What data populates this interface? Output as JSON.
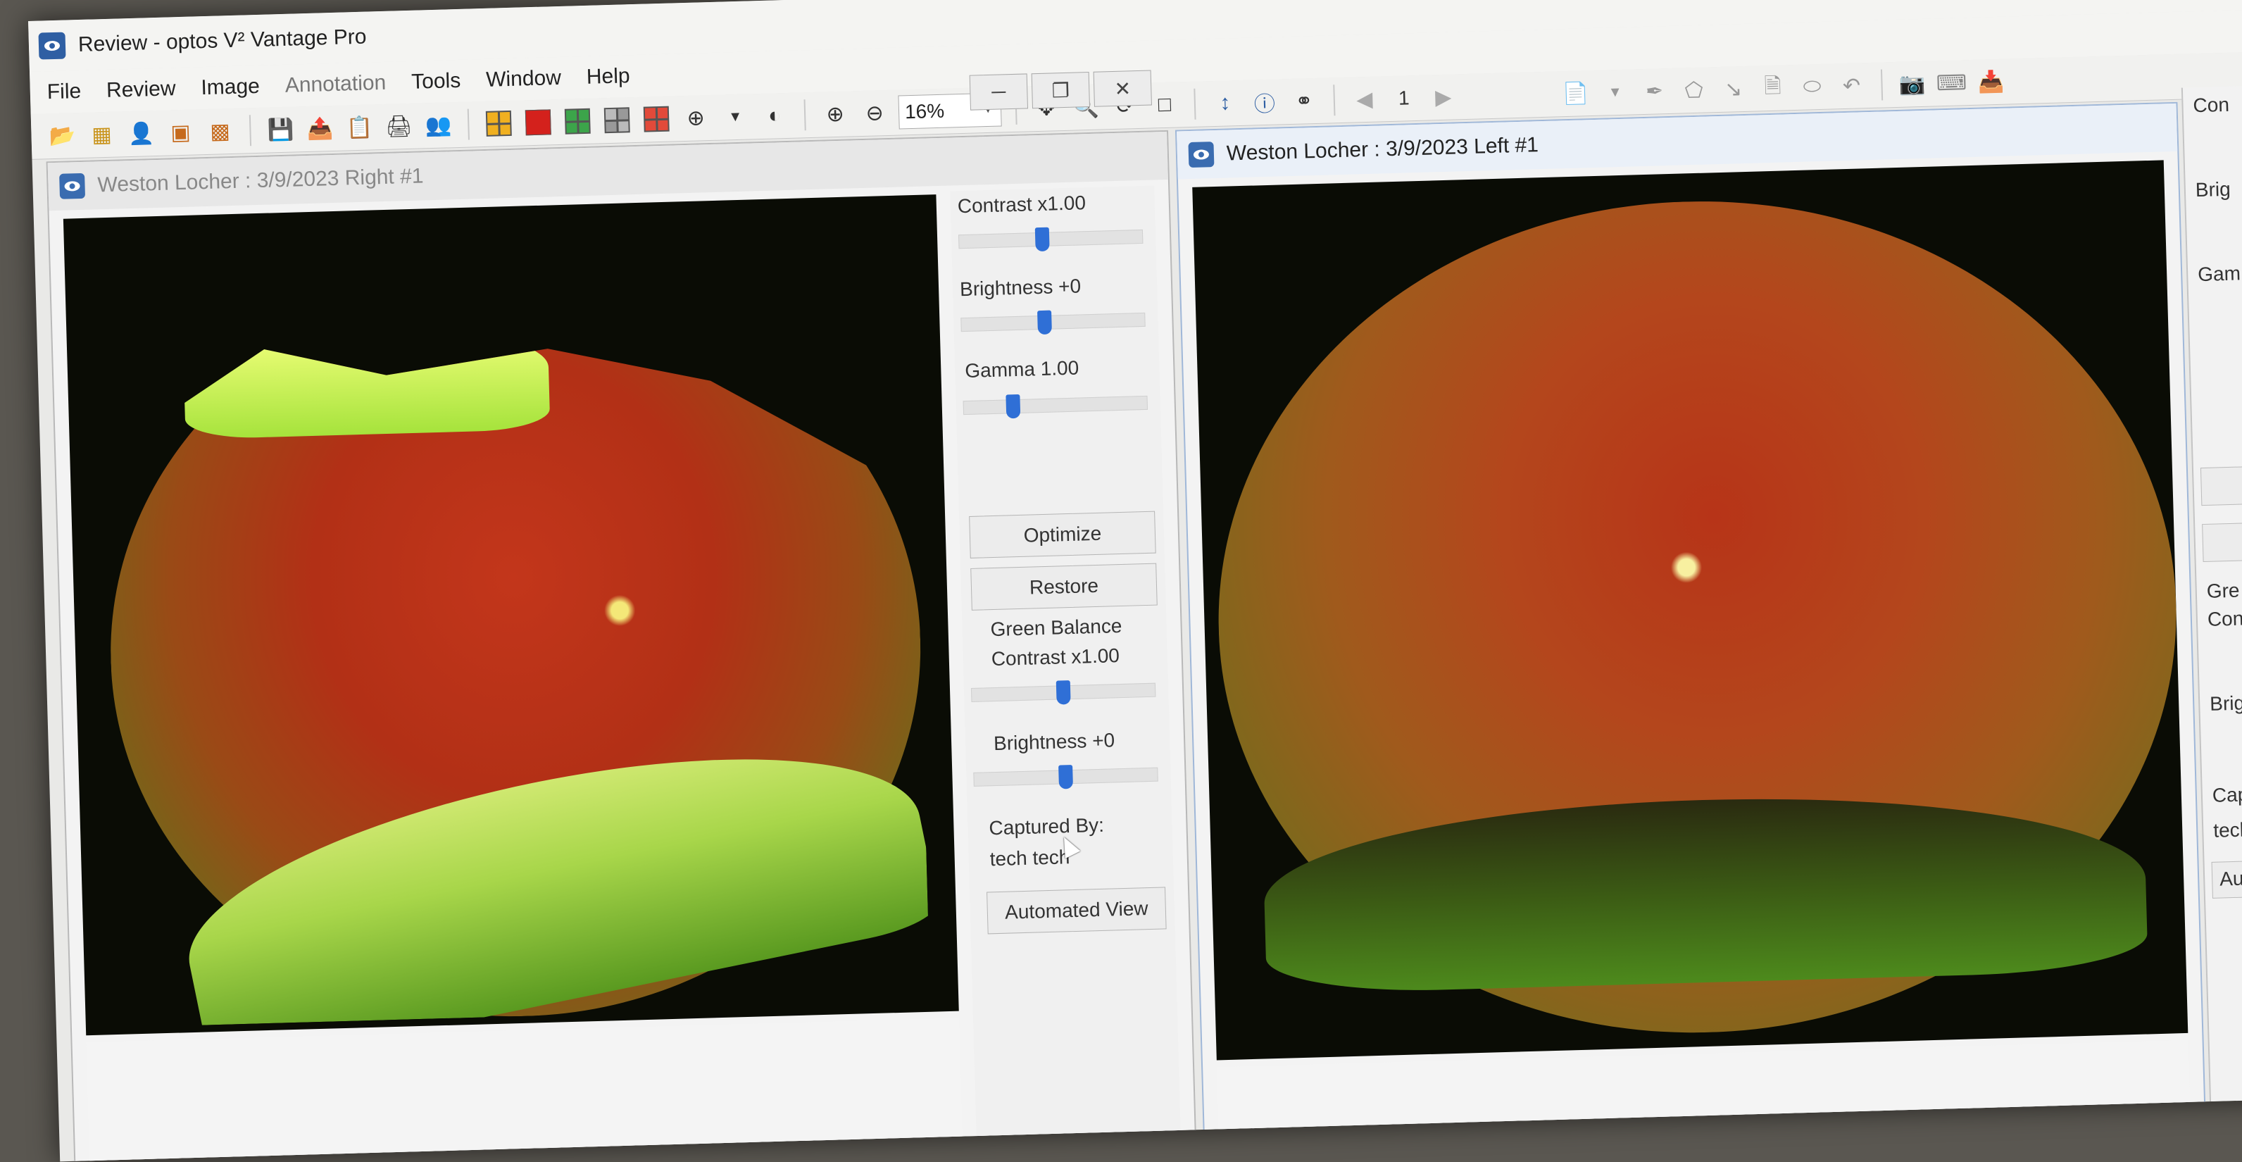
{
  "app": {
    "window_title": "Review - optos V² Vantage Pro"
  },
  "menu": [
    "File",
    "Review",
    "Image",
    "Annotation",
    "Tools",
    "Window",
    "Help"
  ],
  "toolbar": {
    "zoom_value": "16%",
    "page_number": "1"
  },
  "right_window": {
    "title": "Weston Locher : 3/9/2023 Right #1",
    "controls": {
      "contrast_label": "Contrast  x1.00",
      "contrast_level": 0.45,
      "brightness_label": "Brightness  +0",
      "brightness_level": 0.45,
      "gamma_label": "Gamma  1.00",
      "gamma_level": 0.25,
      "optimize_label": "Optimize",
      "restore_label": "Restore",
      "green_balance_title": "Green Balance",
      "green_contrast_label": "Contrast  x1.00",
      "green_contrast_level": 0.5,
      "green_brightness_label": "Brightness  +0",
      "green_brightness_level": 0.5,
      "captured_by_label": "Captured By:",
      "captured_by_value": "tech tech",
      "automated_view_label": "Automated View"
    }
  },
  "left_window": {
    "title": "Weston Locher : 3/9/2023 Left #1"
  },
  "peek_panel": {
    "labels": [
      "Con",
      "Brig",
      "Gam",
      "Gre",
      "Con",
      "Brig",
      "Captu",
      "tech",
      "Au"
    ]
  },
  "colors": {
    "slider_thumb": "#2f6fd6",
    "app_icon": "#2f5fa3",
    "image_background": "#0a0c05"
  }
}
